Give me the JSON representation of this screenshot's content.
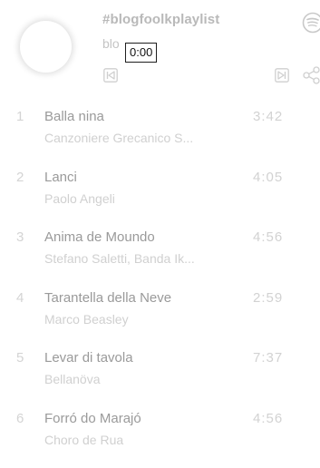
{
  "player": {
    "playlist_title": "#blogfoolkplaylist",
    "subtitle": "blo",
    "current_time": "0:00",
    "icons": {
      "cover": "album-cover-placeholder",
      "prev": "skip-previous-icon",
      "next": "skip-next-icon",
      "share": "share-icon",
      "logo": "spotify-icon"
    }
  },
  "tracks": [
    {
      "number": "1",
      "title": "Balla nina",
      "artist": "Canzoniere Grecanico S...",
      "duration": "3:42"
    },
    {
      "number": "2",
      "title": "Lanci",
      "artist": "Paolo Angeli",
      "duration": "4:05"
    },
    {
      "number": "3",
      "title": "Anima de Moundo",
      "artist": "Stefano Saletti, Banda Ik...",
      "duration": "4:56"
    },
    {
      "number": "4",
      "title": "Tarantella della Neve",
      "artist": "Marco Beasley",
      "duration": "2:59"
    },
    {
      "number": "5",
      "title": "Levar di tavola",
      "artist": "Bellanöva",
      "duration": "7:37"
    },
    {
      "number": "6",
      "title": "Forró do Marajó",
      "artist": "Choro de Rua",
      "duration": "4:56"
    }
  ]
}
